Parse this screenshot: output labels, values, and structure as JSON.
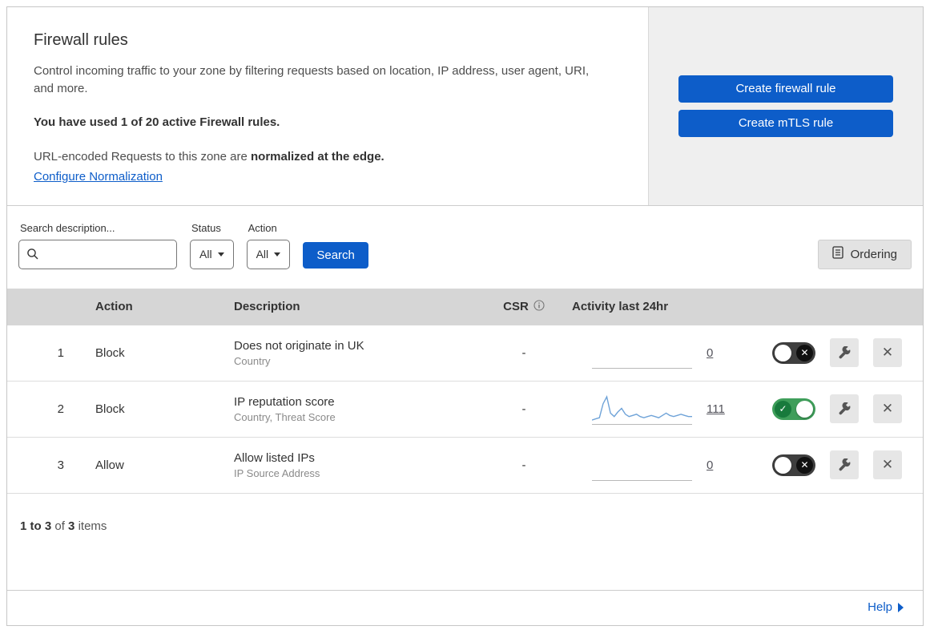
{
  "colors": {
    "primary_blue": "#0d5dc9",
    "toggle_on_green": "#3f9e5a",
    "toggle_off_gray": "#3f3f3f",
    "sparkline_blue": "#6fa3d8",
    "table_header_gray": "#d6d6d6"
  },
  "intro": {
    "title": "Firewall rules",
    "description": "Control incoming traffic to your zone by filtering requests based on location, IP address, user agent, URI, and more.",
    "usage": "You have used 1 of 20 active Firewall rules.",
    "normalization_prefix": "URL-encoded Requests to this zone are ",
    "normalization_bold": "normalized at the edge.",
    "normalization_link": "Configure Normalization"
  },
  "actions": {
    "create_firewall_rule": "Create firewall rule",
    "create_mtls_rule": "Create mTLS rule"
  },
  "filters": {
    "search_label": "Search description...",
    "search_value": "",
    "status_label": "Status",
    "status_value": "All",
    "action_label": "Action",
    "action_value": "All",
    "search_button": "Search",
    "ordering_button": "Ordering"
  },
  "table": {
    "headers": {
      "action": "Action",
      "description": "Description",
      "csr": "CSR",
      "activity": "Activity last 24hr"
    },
    "rows": [
      {
        "index": "1",
        "action": "Block",
        "description": "Does not originate in UK",
        "criteria": "Country",
        "csr": "-",
        "activity_count": "0",
        "enabled": false,
        "sparkline": []
      },
      {
        "index": "2",
        "action": "Block",
        "description": "IP reputation score",
        "criteria": "Country, Threat Score",
        "csr": "-",
        "activity_count": "111",
        "enabled": true,
        "sparkline": [
          2,
          3,
          4,
          16,
          22,
          8,
          5,
          9,
          12,
          7,
          5,
          6,
          7,
          5,
          4,
          5,
          6,
          5,
          4,
          6,
          8,
          6,
          5,
          6,
          7,
          6,
          5,
          5
        ]
      },
      {
        "index": "3",
        "action": "Allow",
        "description": "Allow listed IPs",
        "criteria": "IP Source Address",
        "csr": "-",
        "activity_count": "0",
        "enabled": false,
        "sparkline": []
      }
    ]
  },
  "footer": {
    "range": "1 to 3",
    "of": "of",
    "total": "3",
    "items": "items"
  },
  "help": {
    "label": "Help"
  }
}
